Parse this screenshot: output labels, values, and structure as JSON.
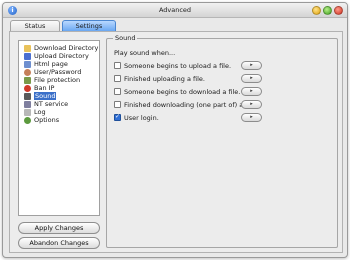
{
  "window": {
    "title": "Advanced"
  },
  "tabs": [
    {
      "label": "Status",
      "active": false
    },
    {
      "label": "Settings",
      "active": true
    }
  ],
  "sidebar": {
    "items": [
      {
        "label": "Download Directory",
        "icon": "folder-icon",
        "color": "#e9c25a",
        "selected": false
      },
      {
        "label": "Upload Directory",
        "icon": "folder-upload-icon",
        "color": "#4b6fd0",
        "selected": false
      },
      {
        "label": "Html page",
        "icon": "html-page-icon",
        "color": "#6e8fcf",
        "selected": false
      },
      {
        "label": "User/Password",
        "icon": "user-icon",
        "color": "#c57f5a",
        "selected": false
      },
      {
        "label": "File protection",
        "icon": "file-protection-icon",
        "color": "#7a9a4a",
        "selected": false
      },
      {
        "label": "Ban IP",
        "icon": "ban-icon",
        "color": "#d03a2a",
        "selected": false
      },
      {
        "label": "Sound",
        "icon": "speaker-icon",
        "color": "#5a5a5a",
        "selected": true
      },
      {
        "label": "NT service",
        "icon": "service-icon",
        "color": "#7f7f9f",
        "selected": false
      },
      {
        "label": "Log",
        "icon": "log-icon",
        "color": "#b8b8b8",
        "selected": false
      },
      {
        "label": "Options",
        "icon": "options-icon",
        "color": "#5c9a3e",
        "selected": false
      }
    ],
    "apply_label": "Apply Changes",
    "abandon_label": "Abandon Changes"
  },
  "sound": {
    "group_title": "Sound",
    "prompt": "Play sound when...",
    "play_icon": "play-icon",
    "play_glyph": "▸",
    "options": [
      {
        "label": "Someone begins to upload a file.",
        "checked": false
      },
      {
        "label": "Finished uploading a file.",
        "checked": false
      },
      {
        "label": "Someone begins to download a file.",
        "checked": false
      },
      {
        "label": "Finished downloading (one part of) a file.",
        "checked": false
      },
      {
        "label": "User login.",
        "checked": true
      }
    ]
  },
  "colors": {
    "accent": "#3b70c9",
    "tab_active": "#6aa8f2"
  }
}
